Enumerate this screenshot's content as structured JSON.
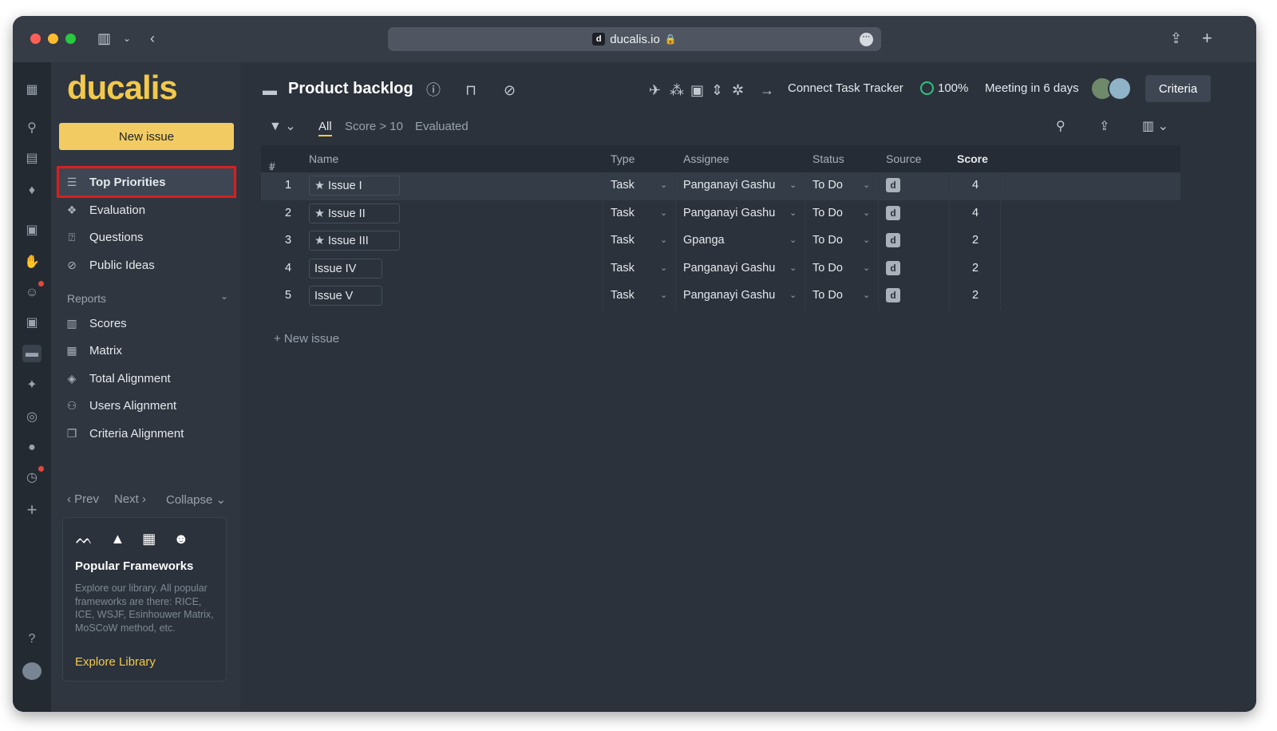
{
  "browser": {
    "url": "ducalis.io",
    "favicon_letter": "d"
  },
  "sidebar": {
    "logo": "ducalis",
    "new_issue_label": "New issue",
    "items": [
      {
        "label": "Top Priorities",
        "icon": "list-icon"
      },
      {
        "label": "Evaluation",
        "icon": "evaluation-icon"
      },
      {
        "label": "Questions",
        "icon": "questions-icon"
      },
      {
        "label": "Public Ideas",
        "icon": "public-ideas-icon"
      }
    ],
    "reports_label": "Reports",
    "reports": [
      {
        "label": "Scores",
        "icon": "scores-icon"
      },
      {
        "label": "Matrix",
        "icon": "matrix-icon"
      },
      {
        "label": "Total Alignment",
        "icon": "layers-icon"
      },
      {
        "label": "Users Alignment",
        "icon": "users-icon"
      },
      {
        "label": "Criteria Alignment",
        "icon": "copy-icon"
      }
    ],
    "pager": {
      "prev": "Prev",
      "next": "Next",
      "collapse": "Collapse"
    },
    "frameworks": {
      "title": "Popular Frameworks",
      "description": "Explore our library. All popular frameworks are there: RICE, ICE, WSJF, Esinhouwer Matrix, MoSCoW method, etc.",
      "link": "Explore Library"
    }
  },
  "header": {
    "title": "Product backlog",
    "connect_label": "Connect Task Tracker",
    "progress": "100%",
    "meeting": "Meeting in 6 days",
    "criteria_label": "Criteria"
  },
  "filters": {
    "tabs": [
      "All",
      "Score > 10",
      "Evaluated"
    ],
    "active": "All"
  },
  "table": {
    "columns": {
      "num": "#",
      "name": "Name",
      "type": "Type",
      "assignee": "Assignee",
      "status": "Status",
      "source": "Source",
      "score": "Score"
    },
    "rows": [
      {
        "num": "1",
        "name": "Issue I",
        "starred": true,
        "type": "Task",
        "assignee": "Panganayi Gashu",
        "status": "To Do",
        "source": "d",
        "score": "4"
      },
      {
        "num": "2",
        "name": "Issue II",
        "starred": true,
        "type": "Task",
        "assignee": "Panganayi Gashu",
        "status": "To Do",
        "source": "d",
        "score": "4"
      },
      {
        "num": "3",
        "name": "Issue III",
        "starred": true,
        "type": "Task",
        "assignee": "Gpanga",
        "status": "To Do",
        "source": "d",
        "score": "2"
      },
      {
        "num": "4",
        "name": "Issue IV",
        "starred": false,
        "type": "Task",
        "assignee": "Panganayi Gashu",
        "status": "To Do",
        "source": "d",
        "score": "2"
      },
      {
        "num": "5",
        "name": "Issue V",
        "starred": false,
        "type": "Task",
        "assignee": "Panganayi Gashu",
        "status": "To Do",
        "source": "d",
        "score": "2"
      }
    ],
    "new_issue_label": "+ New issue"
  },
  "colors": {
    "accent": "#f2c94c",
    "highlight": "#d81f1f",
    "progress": "#2ec27e"
  }
}
